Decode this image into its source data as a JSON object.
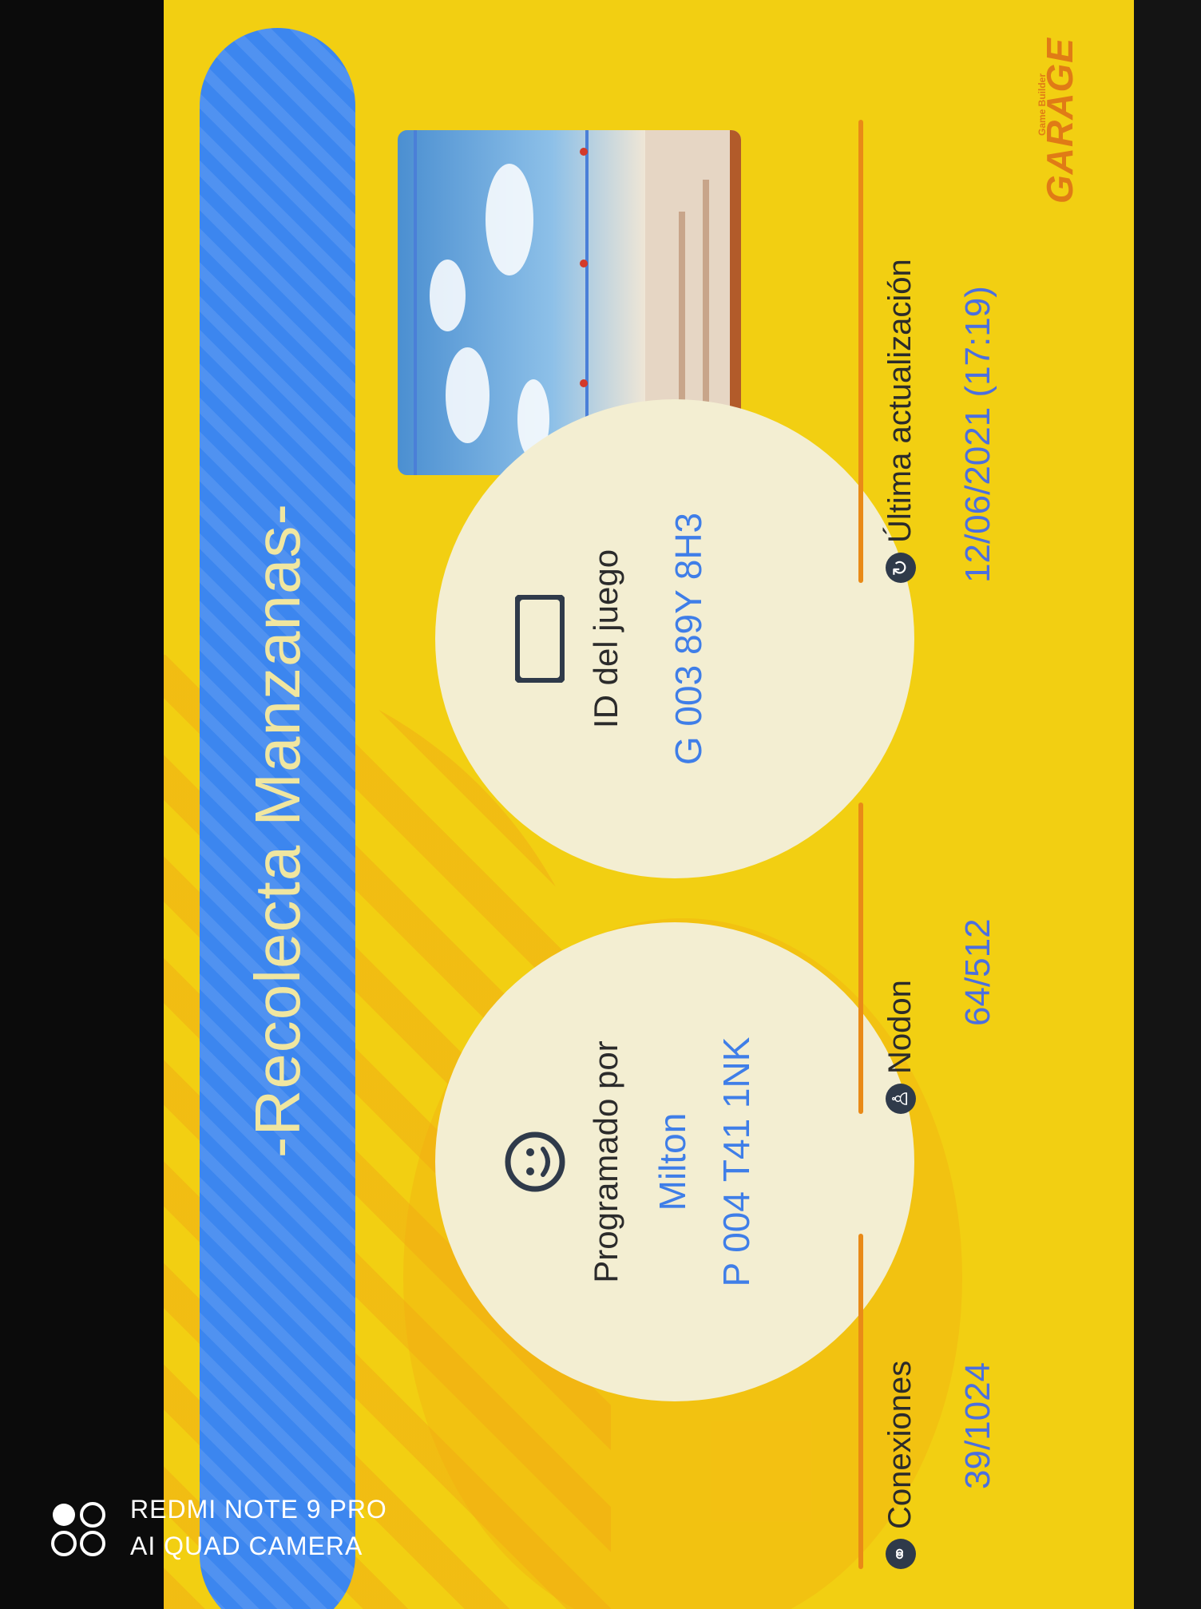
{
  "title": "-Recolecta Manzanas-",
  "brand": {
    "logo_text": "GARAGE",
    "logo_small": "Game Builder"
  },
  "game_id": {
    "label": "ID del juego",
    "value": "G 003 89Y 8H3",
    "icon": "switch-console-icon"
  },
  "programmer": {
    "label": "Programado por",
    "name": "Milton",
    "id": "P 004 T41 1NK",
    "icon": "smiley-face-icon"
  },
  "stats": [
    {
      "icon": "refresh-icon",
      "label": "Última actualización",
      "value": "12/06/2021 (17:19)"
    },
    {
      "icon": "nodon-icon",
      "label": "Nodon",
      "value": "64/512"
    },
    {
      "icon": "connection-icon",
      "label": "Conexiones",
      "value": "39/1024"
    }
  ],
  "watermark": {
    "line1": "REDMI NOTE 9 PRO",
    "line2": "AI QUAD CAMERA"
  },
  "colors": {
    "screen_bg": "#f2cf12",
    "banner": "#3c86ef",
    "accent_blue": "#3f7ee8",
    "orange_line": "#e98a17"
  }
}
